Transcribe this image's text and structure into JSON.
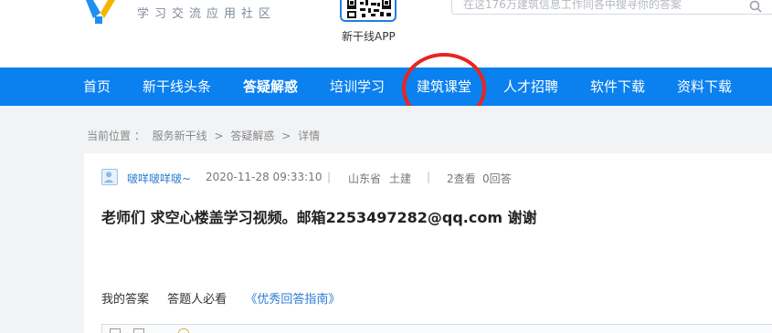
{
  "header": {
    "tagline": "学习交流应用社区",
    "app_label": "新干线APP",
    "search_placeholder": "在这176万建筑信息工作同各中搜寻你的答案"
  },
  "nav": {
    "items": [
      {
        "label": "首页"
      },
      {
        "label": "新干线头条"
      },
      {
        "label": "答疑解惑"
      },
      {
        "label": "培训学习"
      },
      {
        "label": "建筑课堂"
      },
      {
        "label": "人才招聘"
      },
      {
        "label": "软件下载"
      },
      {
        "label": "资料下载"
      }
    ],
    "active_index": 2,
    "highlighted_index": 4
  },
  "breadcrumb": {
    "prefix": "当前位置 ：",
    "items": [
      "服务新干线",
      "答疑解惑",
      "详情"
    ],
    "separator": ">"
  },
  "question": {
    "user": "啵咩啵咩啵~",
    "datetime": "2020-11-28 09:33:10",
    "region": "山东省",
    "category": "土建",
    "views": "2查看",
    "answers": "0回答",
    "title": "老师们 求空心楼盖学习视频。邮箱2253497282@qq.com 谢谢"
  },
  "answer_section": {
    "my_answer": "我的答案",
    "must_read": "答题人必看",
    "guide_link": "《优秀回答指南》"
  },
  "colors": {
    "nav_bg": "#0b80ef",
    "highlight_circle": "#e8261d",
    "link": "#2b7bd1"
  }
}
